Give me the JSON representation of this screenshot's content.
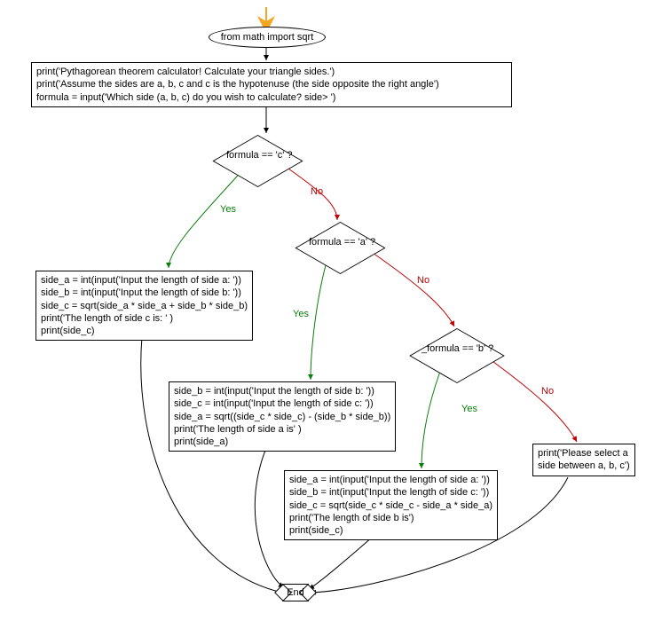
{
  "start": {
    "label": "from math import sqrt"
  },
  "init_block": {
    "l1": "print('Pythagorean theorem calculator! Calculate your triangle sides.')",
    "l2": "print('Assume the sides are a, b, c and c is the hypotenuse (the side opposite the right angle')",
    "l3": "formula = input('Which side (a, b, c) do you wish to calculate? side> ')"
  },
  "dec_c": {
    "label": "formula == 'c' ?",
    "yes": "Yes",
    "no": "No"
  },
  "dec_a": {
    "label": "formula == 'a' ?",
    "yes": "Yes",
    "no": "No"
  },
  "dec_b": {
    "label": "_formula == 'b' ?",
    "yes": "Yes",
    "no": "No"
  },
  "block_c": {
    "l1": "side_a = int(input('Input the length of side a: '))",
    "l2": "side_b = int(input('Input the length of side b: '))",
    "l3": "side_c = sqrt(side_a * side_a + side_b * side_b)",
    "l4": "print('The length of side c is: ' )",
    "l5": "print(side_c)"
  },
  "block_a": {
    "l1": "side_b = int(input('Input the length of side b: '))",
    "l2": "side_c = int(input('Input the length of side c: '))",
    "l3": "side_a = sqrt((side_c * side_c) - (side_b * side_b))",
    "l4": "print('The length of side a is' )",
    "l5": "print(side_a)"
  },
  "block_b": {
    "l1": "side_a = int(input('Input the length of side a: '))",
    "l2": "side_b = int(input('Input the length of side c: '))",
    "l3": "side_c = sqrt(side_c * side_c - side_a * side_a)",
    "l4": "print('The length of side b is')",
    "l5": "print(side_c)"
  },
  "else_block": {
    "l1": "print('Please select a",
    "l2": "side between a, b, c')"
  },
  "end": {
    "label": "End"
  }
}
